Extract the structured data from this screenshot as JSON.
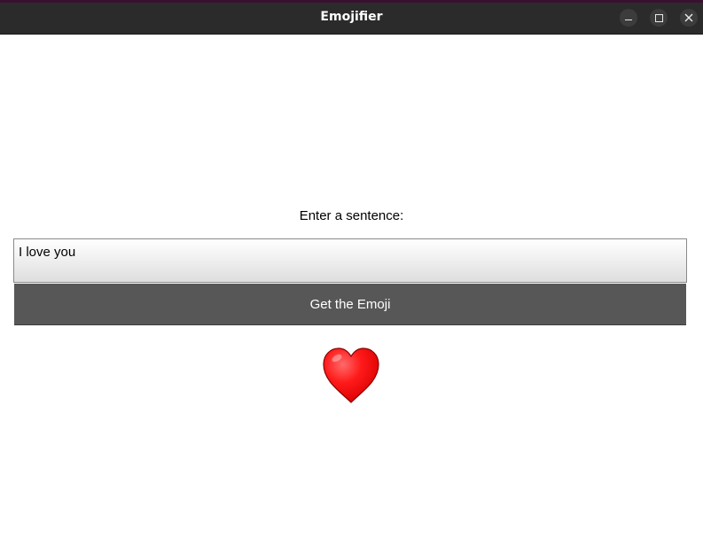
{
  "window": {
    "title": "Emojifier"
  },
  "titlebar": {
    "minimize_icon": "minimize-icon",
    "maximize_icon": "maximize-icon",
    "close_icon": "close-icon"
  },
  "form": {
    "prompt_label": "Enter a sentence:",
    "sentence_value": "I love you",
    "button_label": "Get the Emoji"
  },
  "result": {
    "emoji_icon": "red-heart-icon",
    "emoji_color": "#ff1a1a"
  }
}
